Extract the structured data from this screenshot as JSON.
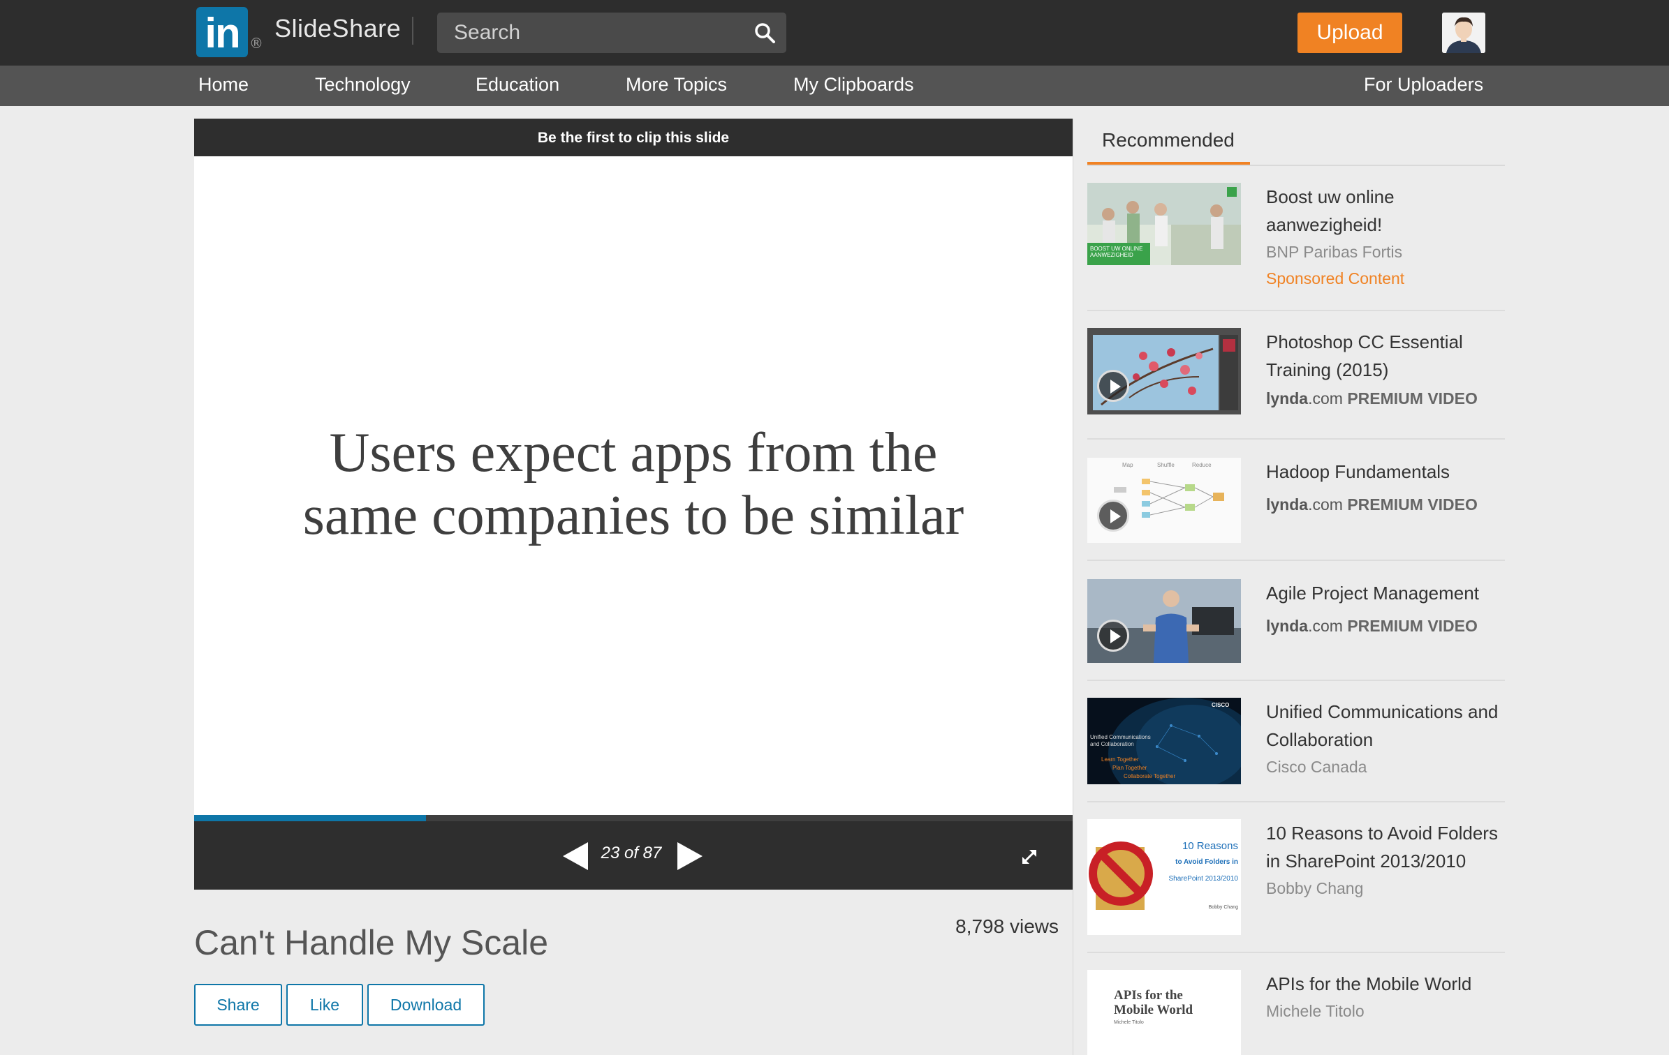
{
  "header": {
    "brand": "SlideShare",
    "logo_text": "in",
    "logo_mark": "®",
    "search_placeholder": "Search",
    "upload_label": "Upload"
  },
  "nav": {
    "items": [
      "Home",
      "Technology",
      "Education",
      "More Topics",
      "My Clipboards"
    ],
    "uploaders": "For Uploaders"
  },
  "player": {
    "clip_prompt": "Be the first to clip this slide",
    "slide_line1": "Users expect apps from the",
    "slide_line2": "same companies to be similar",
    "page_counter": "23 of 87",
    "progress_fraction": 0.264
  },
  "presentation": {
    "title": "Can't Handle My Scale",
    "views": "8,798 views",
    "actions": {
      "share": "Share",
      "like": "Like",
      "download": "Download"
    }
  },
  "sidebar": {
    "heading": "Recommended",
    "items": [
      {
        "title": "Boost uw online aanwezigheid!",
        "author": "BNP Paribas Fortis",
        "tag": "Sponsored Content",
        "thumb_caption": "BOOST UW ONLINE AANWEZIGHEID"
      },
      {
        "title": "Photoshop CC Essential Training (2015)",
        "brand": "lynda",
        "brand_suffix": ".com",
        "tag": "PREMIUM VIDEO"
      },
      {
        "title": "Hadoop Fundamentals",
        "brand": "lynda",
        "brand_suffix": ".com",
        "tag": "PREMIUM VIDEO",
        "thumb_labels": [
          "Map",
          "Shuffle",
          "Reduce"
        ]
      },
      {
        "title": "Agile Project Management",
        "brand": "lynda",
        "brand_suffix": ".com",
        "tag": "PREMIUM VIDEO"
      },
      {
        "title": "Unified Communications and Collaboration",
        "author": "Cisco Canada",
        "thumb_brand": "CISCO",
        "thumb_title": "Unified Communications and Collaboration",
        "thumb_lines": [
          "Learn Together",
          "Plan Together",
          "Collaborate Together"
        ]
      },
      {
        "title": "10 Reasons to Avoid Folders in SharePoint 2013/2010",
        "author": "Bobby Chang",
        "thumb_lines": [
          "10 Reasons",
          "to Avoid Folders in",
          "SharePoint 2013/2010",
          "Bobby Chang"
        ]
      },
      {
        "title": "APIs for the Mobile World",
        "author": "Michele Titolo",
        "thumb_title": "APIs for the Mobile World",
        "thumb_sub": "Michele Titolo"
      }
    ]
  },
  "colors": {
    "accent": "#f08223",
    "brand_blue": "#0e76a8",
    "topbar": "#2d2d2d",
    "navbar": "#545454"
  }
}
